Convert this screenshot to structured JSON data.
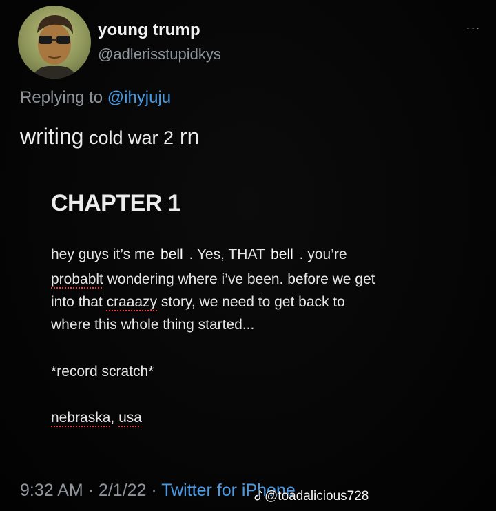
{
  "tweet": {
    "display_name": "young trump",
    "handle": "@adlerisstupidkys",
    "more_icon": "···",
    "replying_prefix": "Replying to",
    "replying_mention": "@ihyjuju",
    "body_word1": "writing",
    "body_rest": " cold war 2",
    "body_end": " rn",
    "timestamp": "9:32 AM · 2/1/22 · ",
    "source": "Twitter for iPhone"
  },
  "story": {
    "title": "CHAPTER 1",
    "l1_a": "hey guys it’s me ",
    "l1_name1": "bell",
    "l1_b": ". Yes, THAT ",
    "l1_name2": "bell",
    "l1_c": ". you’re",
    "l2_a": "probablt",
    "l2_b": " wondering where i’ve been. before we get",
    "l3_a": "into that ",
    "l3_b": "craaazy",
    "l3_c": " story, we need to get back to",
    "l4": "where this whole thing started...",
    "l5": "*record scratch*",
    "l6_a": "nebraska",
    "l6_b": ", ",
    "l6_c": "usa"
  },
  "watermark": {
    "text": "@toadalicious728"
  }
}
